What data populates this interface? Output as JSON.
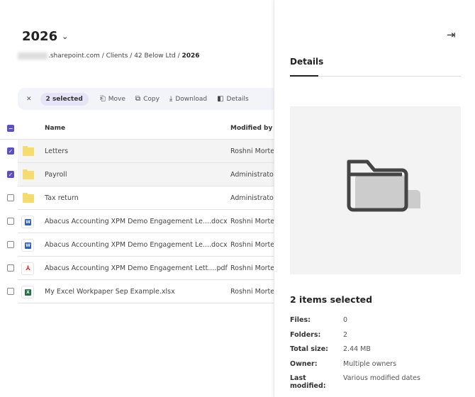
{
  "header": {
    "title": "2026",
    "breadcrumb": {
      "host": ".sharepoint.com",
      "parts": [
        "Clients",
        "42 Below Ltd"
      ],
      "current": "2026",
      "sep": "/"
    }
  },
  "toolbar": {
    "selected_label": "2 selected",
    "move": "Move",
    "copy": "Copy",
    "download": "Download",
    "details": "Details"
  },
  "table": {
    "columns": {
      "name": "Name",
      "modified_by": "Modified by"
    },
    "rows": [
      {
        "name": "Letters",
        "modified_by": "Roshni Morten",
        "type": "folder",
        "checked": true
      },
      {
        "name": "Payroll",
        "modified_by": "Administrator",
        "type": "folder",
        "checked": true
      },
      {
        "name": "Tax return",
        "modified_by": "Administrator",
        "type": "folder",
        "checked": false
      },
      {
        "name": "Abacus Accounting XPM Demo Engagement Le....docx",
        "modified_by": "Roshni Morten",
        "type": "word",
        "checked": false
      },
      {
        "name": "Abacus Accounting XPM Demo Engagement Le....docx",
        "modified_by": "Roshni Morten",
        "type": "word",
        "checked": false
      },
      {
        "name": "Abacus Accounting XPM Demo Engagement Lett....pdf",
        "modified_by": "Roshni Morten",
        "type": "pdf",
        "checked": false
      },
      {
        "name": "My Excel Workpaper Sep Example.xlsx",
        "modified_by": "Roshni Morten",
        "type": "excel",
        "checked": false
      }
    ]
  },
  "panel": {
    "tab": "Details",
    "summary": "2 items selected",
    "fields": [
      {
        "label": "Files:",
        "value": "0"
      },
      {
        "label": "Folders:",
        "value": "2"
      },
      {
        "label": "Total size:",
        "value": "2.44 MB"
      },
      {
        "label": "Owner:",
        "value": "Multiple owners"
      },
      {
        "label": "Last modified:",
        "value": "Various modified dates"
      }
    ]
  },
  "colors": {
    "accent": "#5b4fc4",
    "folder": "#f5dc6e",
    "word": "#2b5fc7",
    "pdf": "#d9342b",
    "excel": "#217346"
  }
}
